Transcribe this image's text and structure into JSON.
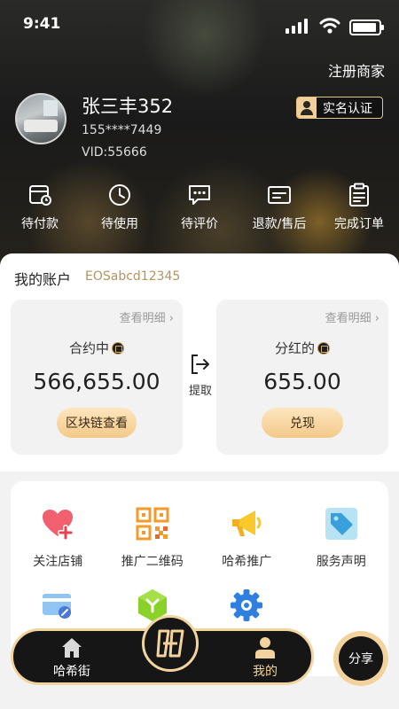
{
  "status_bar": {
    "time": "9:41"
  },
  "header": {
    "register_merchant": "注册商家",
    "user": {
      "name": "张三丰352",
      "phone": "155****7449",
      "vid": "VID:55666"
    },
    "verify_badge": "实名认证"
  },
  "orders": [
    {
      "label": "待付款",
      "icon": "payment-pending-icon"
    },
    {
      "label": "待使用",
      "icon": "clock-icon"
    },
    {
      "label": "待评价",
      "icon": "comment-icon"
    },
    {
      "label": "退款/售后",
      "icon": "refund-icon"
    },
    {
      "label": "完成订单",
      "icon": "clipboard-icon"
    }
  ],
  "account": {
    "title": "我的账户",
    "account_id": "EOSabcd12345",
    "contract": {
      "detail_link": "查看明细 ›",
      "label": "合约中",
      "value": "566,655.00",
      "button": "区块链查看"
    },
    "withdraw_label": "提取",
    "dividend": {
      "detail_link": "查看明细 ›",
      "label": "分红的",
      "value": "655.00",
      "button": "兑现"
    }
  },
  "services": [
    {
      "label": "关注店铺",
      "icon": "heart-plus-icon"
    },
    {
      "label": "推广二维码",
      "icon": "qr-code-icon"
    },
    {
      "label": "哈希推广",
      "icon": "megaphone-icon"
    },
    {
      "label": "服务声明",
      "icon": "tag-icon"
    },
    {
      "label": "",
      "icon": "card-link-icon"
    },
    {
      "label": "",
      "icon": "hexagon-icon"
    },
    {
      "label": "",
      "icon": "gear-icon"
    }
  ],
  "bottom_nav": {
    "home": "哈希街",
    "mine": "我的",
    "share": "分享"
  },
  "colors": {
    "gold_accent": "#f2d49f",
    "account_id": "#b59361",
    "nav_background": "#161616"
  }
}
